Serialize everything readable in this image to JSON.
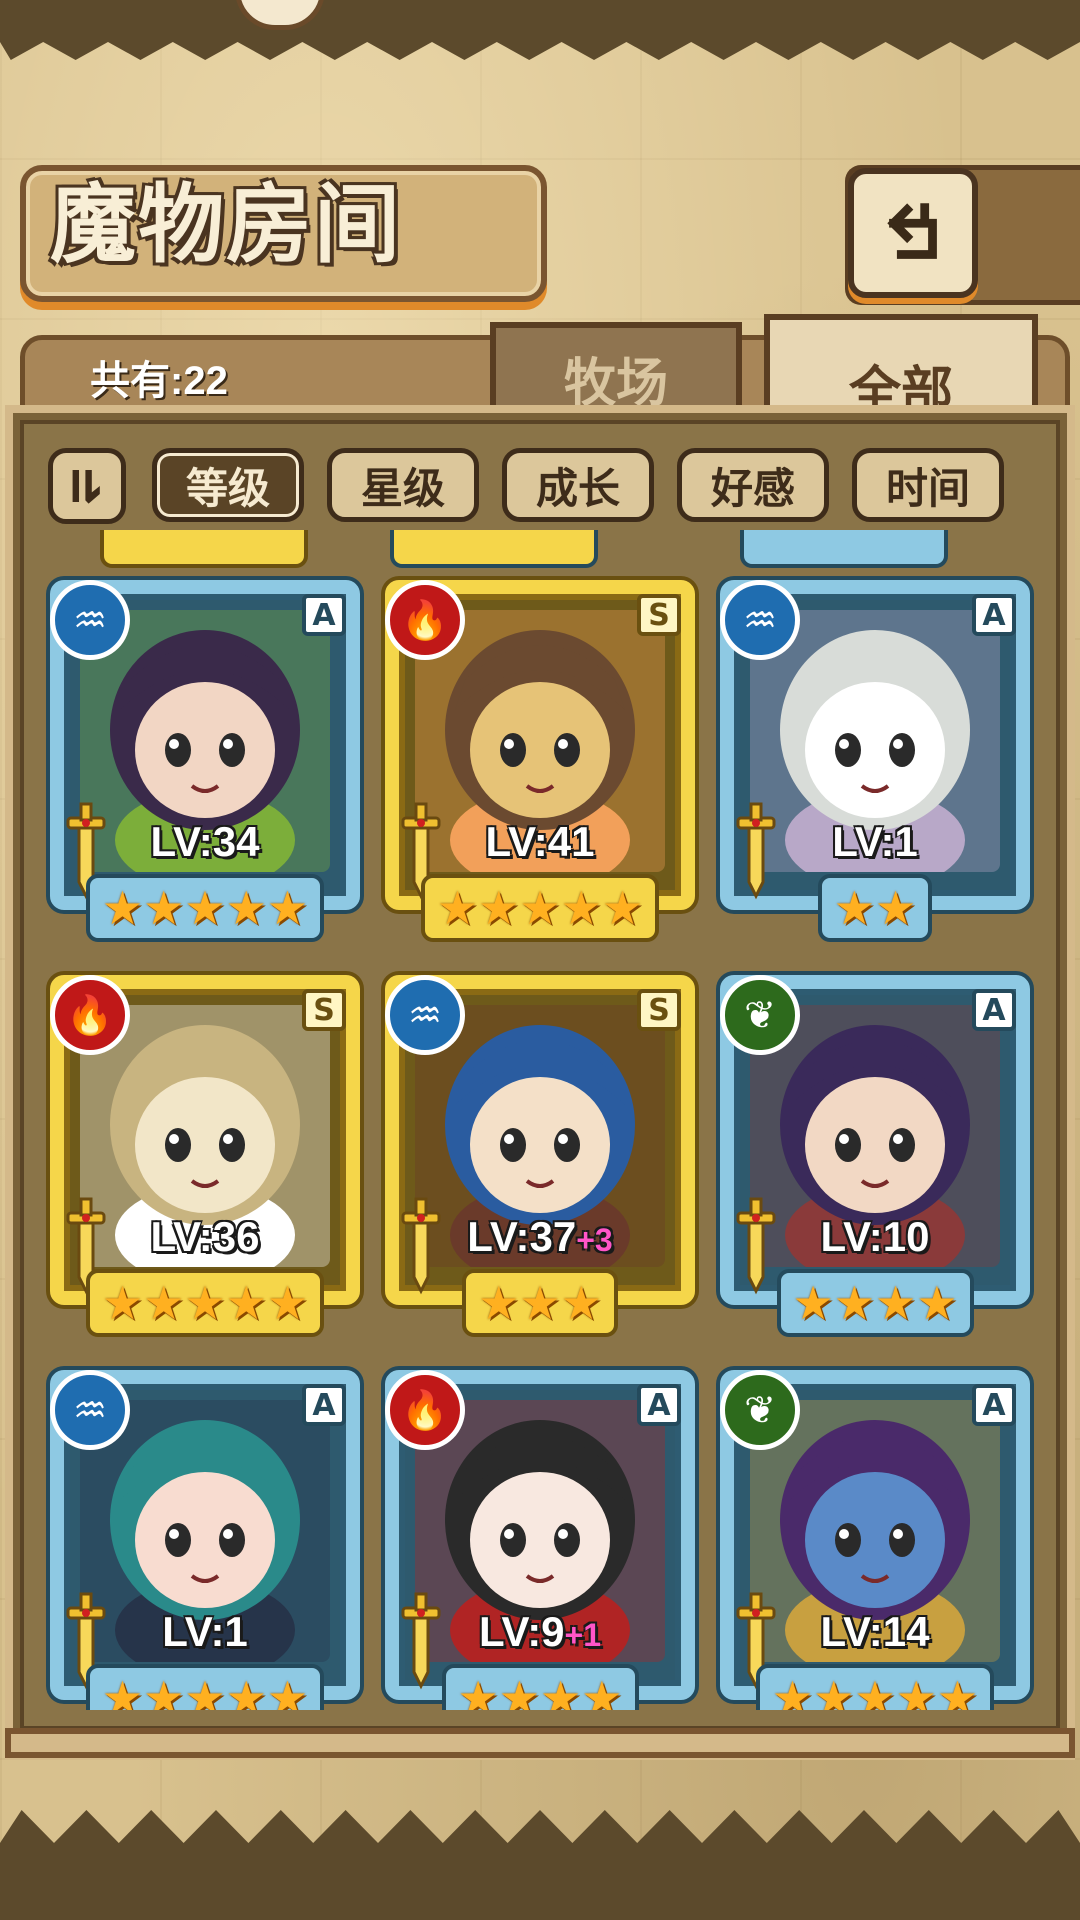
{
  "header": {
    "title": "魔物房间",
    "count_text": "共有:22"
  },
  "tabs": [
    {
      "label": "牧场",
      "active": false
    },
    {
      "label": "全部",
      "active": true
    }
  ],
  "sort_buttons": [
    {
      "label": "等级",
      "active": true
    },
    {
      "label": "星级",
      "active": false
    },
    {
      "label": "成长",
      "active": false
    },
    {
      "label": "好感",
      "active": false
    },
    {
      "label": "时间",
      "active": false
    }
  ],
  "cards": [
    {
      "element": "water",
      "rank": "A",
      "level": "LV:34",
      "plus": "",
      "stars": 5,
      "tier": "a",
      "palette": [
        "#3a2a4a",
        "#f2d6c4",
        "#7cae3a"
      ]
    },
    {
      "element": "fire",
      "rank": "S",
      "level": "LV:41",
      "plus": "",
      "stars": 5,
      "tier": "s",
      "palette": [
        "#6b4a30",
        "#e6c377",
        "#f2a05a"
      ]
    },
    {
      "element": "water",
      "rank": "A",
      "level": "LV:1",
      "plus": "",
      "stars": 2,
      "tier": "a",
      "palette": [
        "#d8dcd8",
        "#ffffff",
        "#b8a8c8"
      ]
    },
    {
      "element": "fire",
      "rank": "S",
      "level": "LV:36",
      "plus": "",
      "stars": 5,
      "tier": "s",
      "palette": [
        "#c8b480",
        "#f2e6c8",
        "#ffffff"
      ]
    },
    {
      "element": "water",
      "rank": "S",
      "level": "LV:37",
      "plus": "+3",
      "stars": 3,
      "tier": "s",
      "palette": [
        "#2a5ca0",
        "#f4e0c8",
        "#6a3a2a"
      ]
    },
    {
      "element": "wood",
      "rank": "A",
      "level": "LV:10",
      "plus": "",
      "stars": 4,
      "tier": "a",
      "palette": [
        "#3a2a5a",
        "#f2d8c4",
        "#8a3a3a"
      ]
    },
    {
      "element": "water",
      "rank": "A",
      "level": "LV:1",
      "plus": "",
      "stars": 5,
      "tier": "a",
      "palette": [
        "#2a8a8a",
        "#f8dcd0",
        "#26344a"
      ]
    },
    {
      "element": "fire",
      "rank": "A",
      "level": "LV:9",
      "plus": "+1",
      "stars": 4,
      "tier": "a",
      "palette": [
        "#2a2a2a",
        "#f8e8e0",
        "#b02424"
      ]
    },
    {
      "element": "wood",
      "rank": "A",
      "level": "LV:14",
      "plus": "",
      "stars": 5,
      "tier": "a",
      "palette": [
        "#4a2a6a",
        "#5a8ac8",
        "#c8a040"
      ]
    }
  ],
  "icons": {
    "back": "back-arrow-icon",
    "sort_toggle": "sort-order-icon",
    "water": "water-element-icon",
    "fire": "fire-element-icon",
    "wood": "wood-element-icon",
    "sword": "sword-icon",
    "star": "star-icon"
  }
}
